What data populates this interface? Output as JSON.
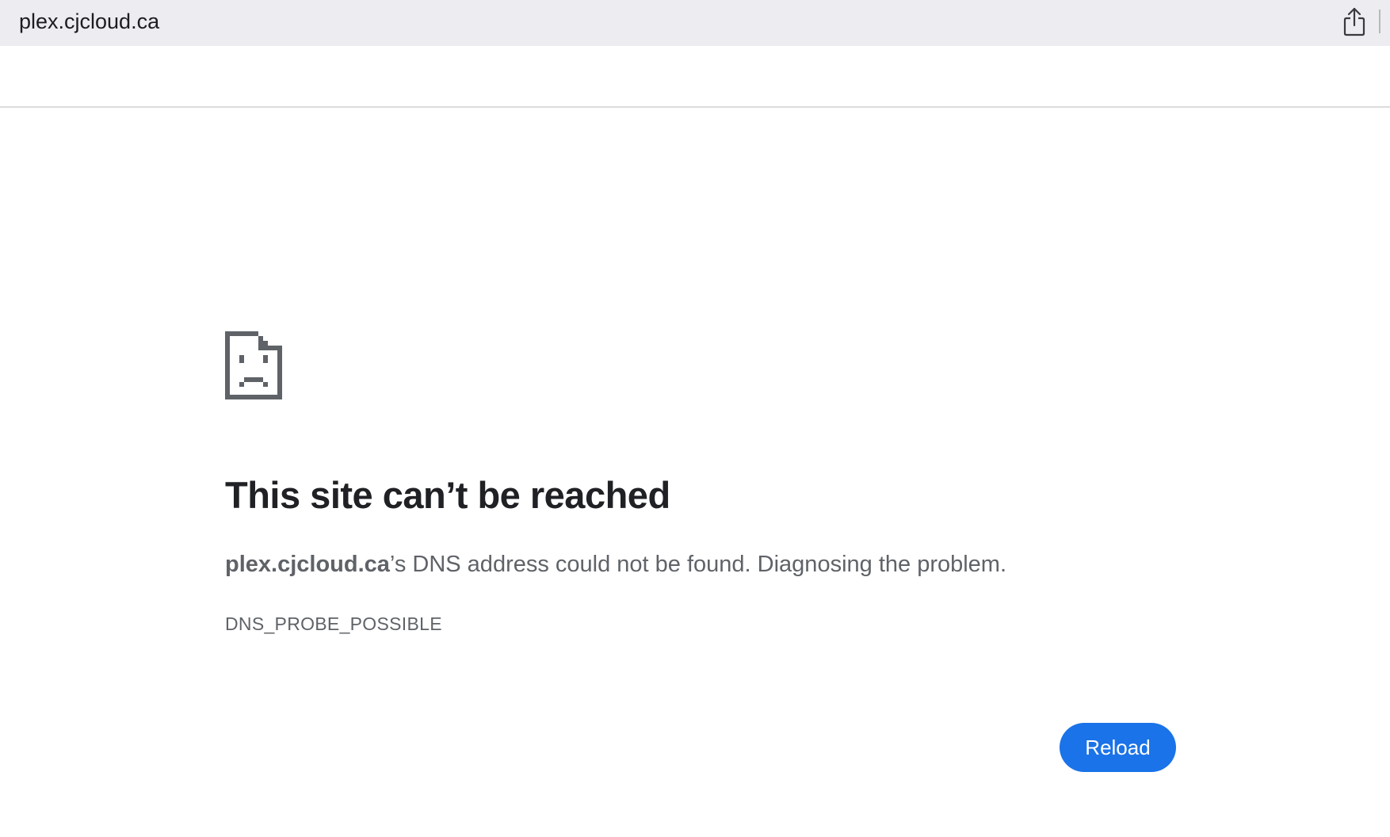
{
  "browser": {
    "url": "plex.cjcloud.ca",
    "share_icon": "share-icon"
  },
  "error": {
    "icon": "sad-file-icon",
    "title": "This site can’t be reached",
    "host": "plex.cjcloud.ca",
    "message_suffix": "’s DNS address could not be found. Diagnosing the problem.",
    "code": "DNS_PROBE_POSSIBLE",
    "reload_label": "Reload"
  },
  "colors": {
    "accent": "#1a73e8",
    "heading": "#202124",
    "body_text": "#5f6368",
    "toolbar_bg": "#ececf1"
  }
}
